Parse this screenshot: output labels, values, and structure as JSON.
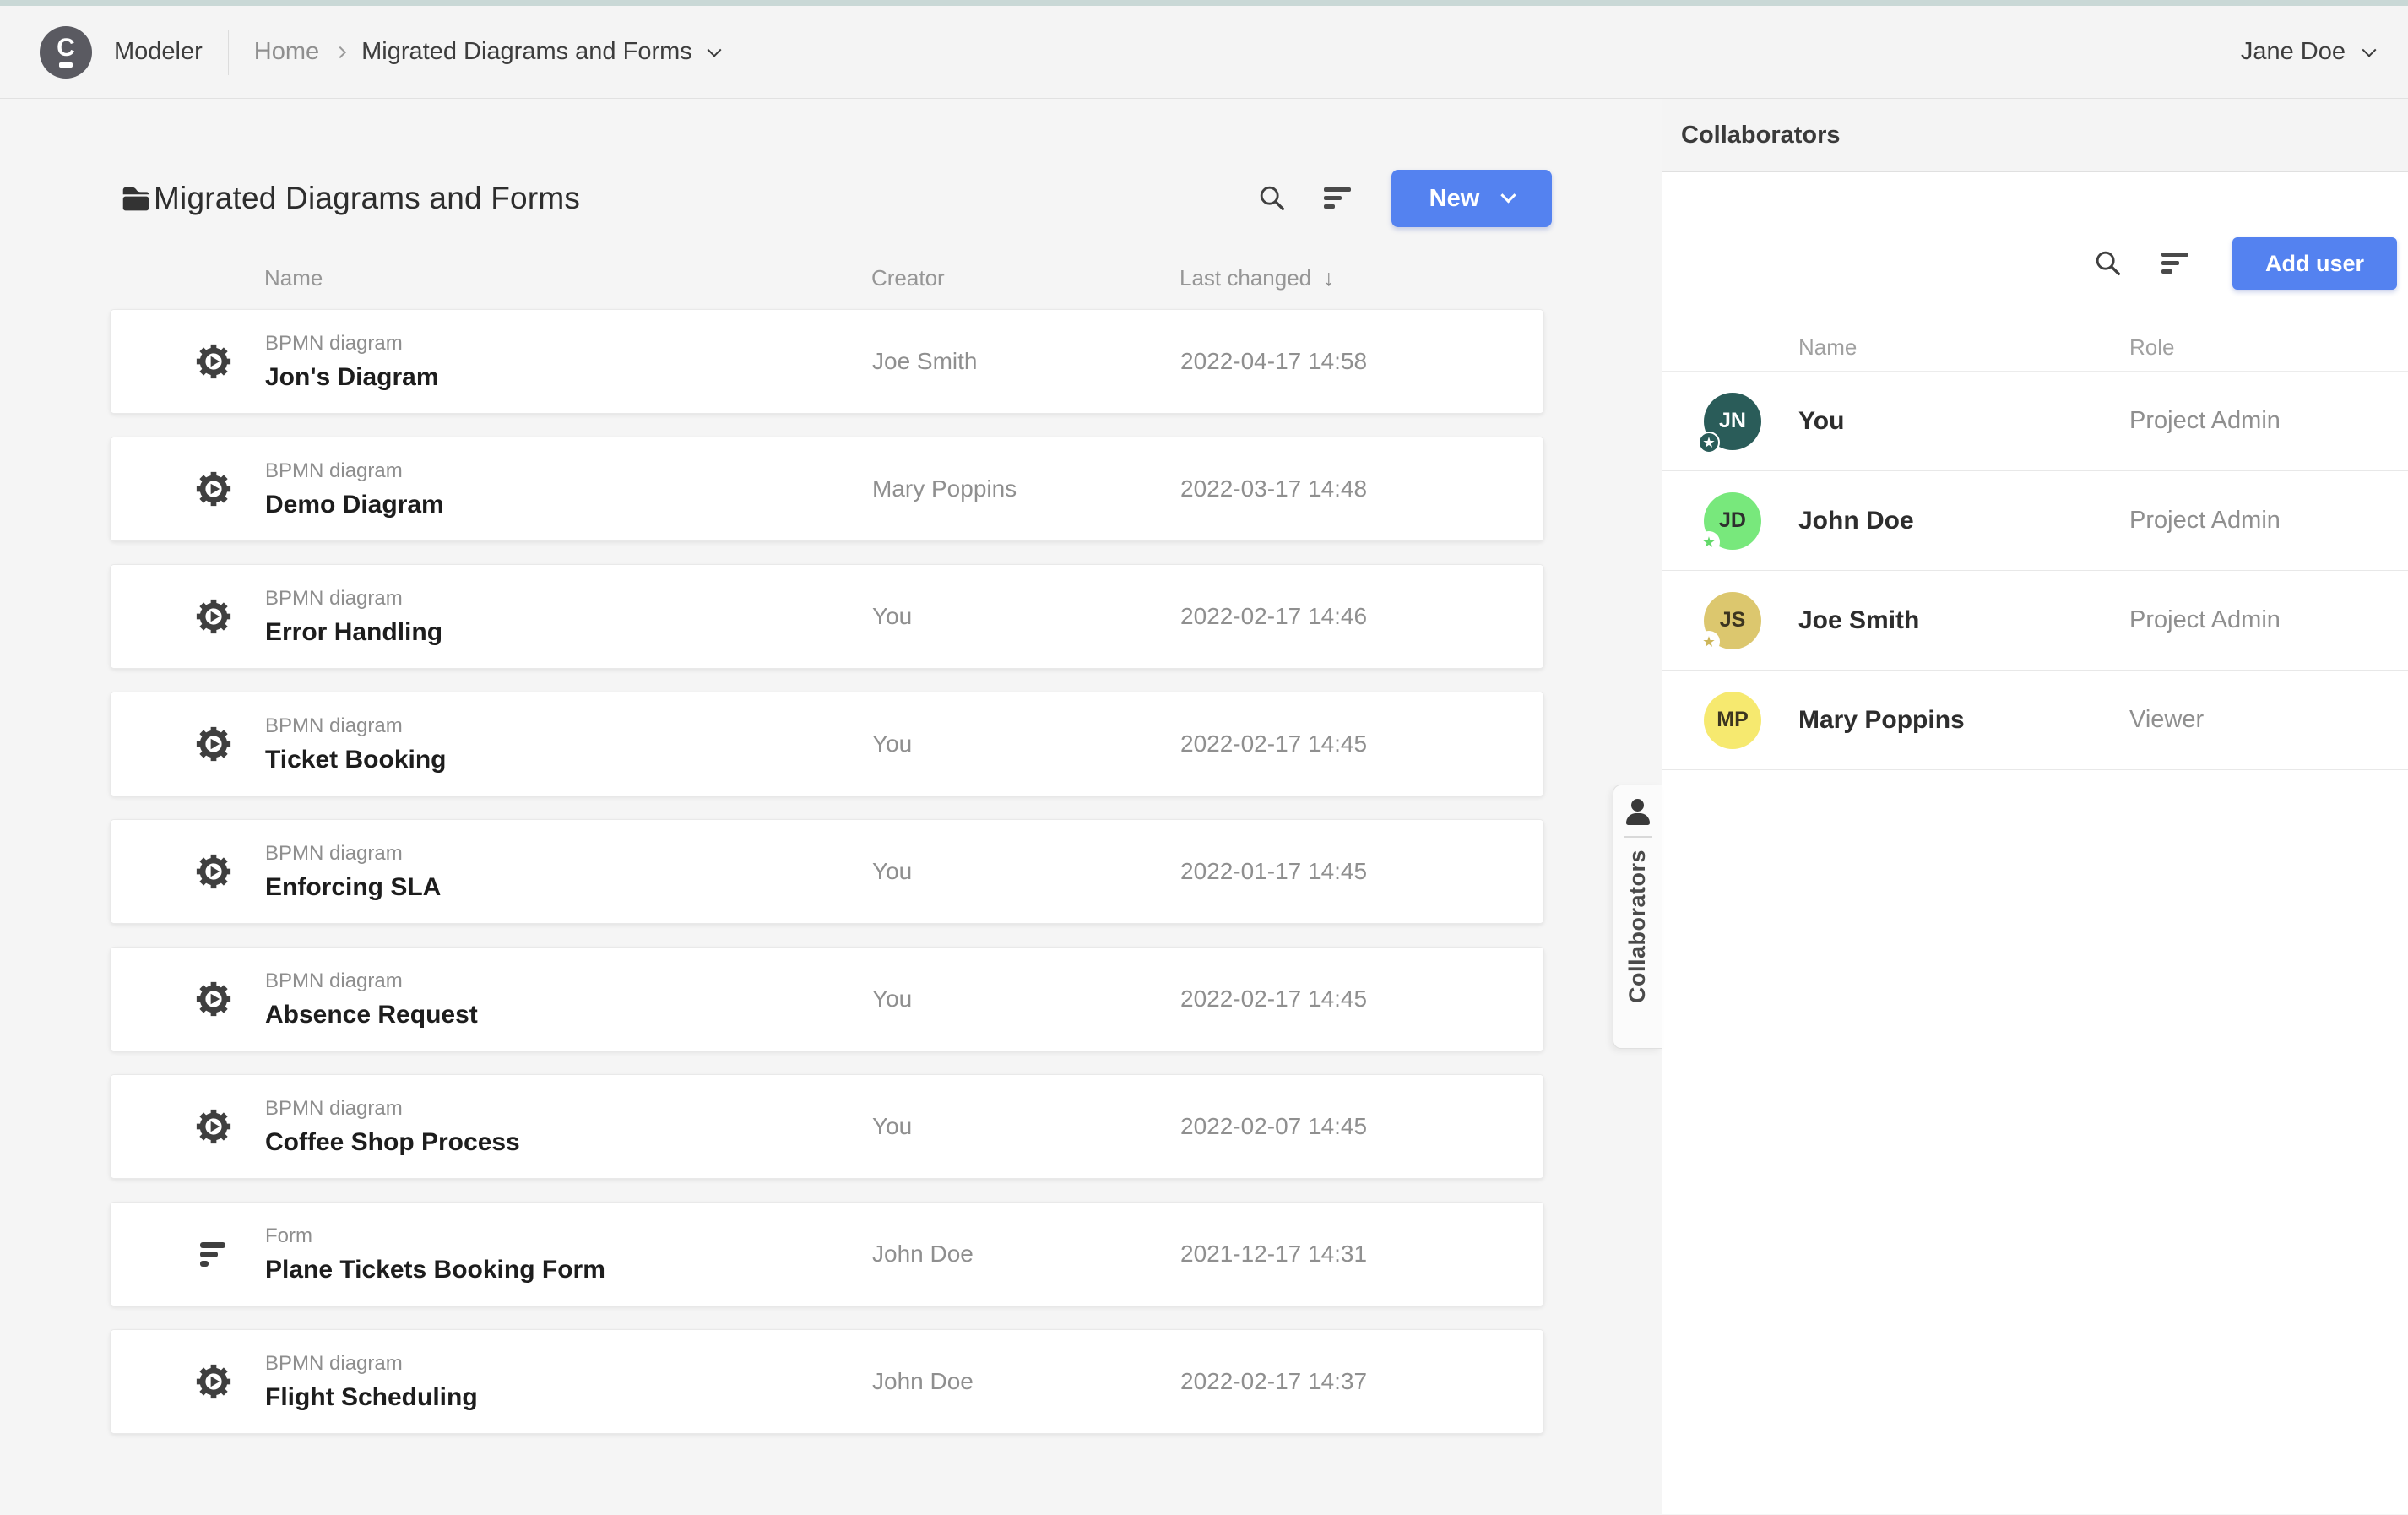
{
  "topbar": {
    "logo_letter": "C",
    "brand": "Modeler",
    "breadcrumb": {
      "home": "Home",
      "current": "Migrated Diagrams and Forms"
    },
    "user_name": "Jane Doe"
  },
  "main": {
    "title": "Migrated Diagrams and Forms",
    "new_button_label": "New",
    "columns": {
      "name": "Name",
      "creator": "Creator",
      "last_changed": "Last changed",
      "sort_arrow": "↓"
    },
    "files": [
      {
        "icon": "bpmn",
        "type_label": "BPMN diagram",
        "name": "Jon's Diagram",
        "creator": "Joe Smith",
        "last_changed": "2022-04-17 14:58"
      },
      {
        "icon": "bpmn",
        "type_label": "BPMN diagram",
        "name": "Demo Diagram",
        "creator": "Mary Poppins",
        "last_changed": "2022-03-17 14:48"
      },
      {
        "icon": "bpmn",
        "type_label": "BPMN diagram",
        "name": "Error Handling",
        "creator": "You",
        "last_changed": "2022-02-17 14:46"
      },
      {
        "icon": "bpmn",
        "type_label": "BPMN diagram",
        "name": "Ticket Booking",
        "creator": "You",
        "last_changed": "2022-02-17 14:45"
      },
      {
        "icon": "bpmn",
        "type_label": "BPMN diagram",
        "name": "Enforcing SLA",
        "creator": "You",
        "last_changed": "2022-01-17 14:45"
      },
      {
        "icon": "bpmn",
        "type_label": "BPMN diagram",
        "name": "Absence Request",
        "creator": "You",
        "last_changed": "2022-02-17 14:45"
      },
      {
        "icon": "bpmn",
        "type_label": "BPMN diagram",
        "name": "Coffee Shop Process",
        "creator": "You",
        "last_changed": "2022-02-07 14:45"
      },
      {
        "icon": "form",
        "type_label": "Form",
        "name": "Plane Tickets Booking Form",
        "creator": "John Doe",
        "last_changed": "2021-12-17 14:31"
      },
      {
        "icon": "bpmn",
        "type_label": "BPMN diagram",
        "name": "Flight Scheduling",
        "creator": "John Doe",
        "last_changed": "2022-02-17 14:37"
      }
    ]
  },
  "collaborators": {
    "panel_title": "Collaborators",
    "tab_label": "Collaborators",
    "add_user_label": "Add user",
    "columns": {
      "name": "Name",
      "role": "Role"
    },
    "star_glyph": "★",
    "users": [
      {
        "initials": "JN",
        "name": "You",
        "role": "Project Admin",
        "avatar_bg": "#2a5c59",
        "avatar_text": "#ffffff",
        "star": true,
        "badge_bg": "#2a5c59",
        "badge_star": "#ffffff"
      },
      {
        "initials": "JD",
        "name": "John Doe",
        "role": "Project Admin",
        "avatar_bg": "#78e87c",
        "avatar_text": "#2e2e2e",
        "star": true,
        "badge_bg": "#ffffff",
        "badge_star": "#63d96a"
      },
      {
        "initials": "JS",
        "name": "Joe Smith",
        "role": "Project Admin",
        "avatar_bg": "#dcc76e",
        "avatar_text": "#3c3520",
        "star": true,
        "badge_bg": "#ffffff",
        "badge_star": "#cdb65a"
      },
      {
        "initials": "MP",
        "name": "Mary Poppins",
        "role": "Viewer",
        "avatar_bg": "#f6e96f",
        "avatar_text": "#3c3520",
        "star": false
      }
    ]
  },
  "colors": {
    "accent_blue": "#5482f0",
    "top_strip": "#c9d8d6"
  }
}
